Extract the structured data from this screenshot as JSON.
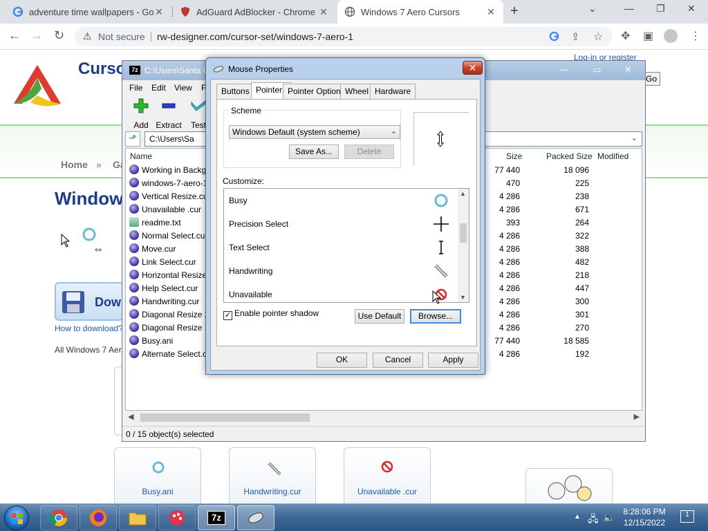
{
  "browser": {
    "tabs": [
      {
        "title": "adventure time wallpapers - Goo"
      },
      {
        "title": "AdGuard AdBlocker - Chrome W"
      },
      {
        "title": "Windows 7 Aero Cursors"
      }
    ],
    "new_tab_glyph": "+",
    "omnibox": {
      "security_label": "Not secure",
      "url": "rw-designer.com/cursor-set/windows-7-aero-1"
    }
  },
  "webpage": {
    "site_title": "Cursor",
    "login_text": "Log-in or register",
    "go_label": "Go",
    "breadcrumb": [
      "Home",
      "»",
      "Ga"
    ],
    "heading": "Window",
    "download_label": "Dow",
    "how_to": "How to download?",
    "all_windows": "All Windows 7 Aer",
    "cards": [
      {
        "name": "Busy.ani"
      },
      {
        "name": "Handwriting.cur"
      },
      {
        "name": "Unavailable .cur"
      }
    ]
  },
  "zip_window": {
    "title": "C:\\Users\\Santa C",
    "app_badge": "7z",
    "menu": [
      "File",
      "Edit",
      "View",
      "F"
    ],
    "tools": [
      {
        "label": "Add",
        "icon": "plus-icon"
      },
      {
        "label": "Extract",
        "icon": "minus-icon"
      },
      {
        "label": "Test",
        "icon": "check-icon"
      }
    ],
    "path": "C:\\Users\\Sa",
    "columns": {
      "name": "Name",
      "size": "Size",
      "packed": "Packed Size",
      "modified": "Modified"
    },
    "files": [
      {
        "name": "Working in Backg",
        "size": "77 440",
        "packed": "18 096"
      },
      {
        "name": "windows-7-aero-1",
        "size": "470",
        "packed": "225"
      },
      {
        "name": "Vertical Resize.cur",
        "size": "4 286",
        "packed": "238"
      },
      {
        "name": "Unavailable .cur",
        "size": "4 286",
        "packed": "671"
      },
      {
        "name": "readme.txt",
        "size": "393",
        "packed": "264",
        "type": "txt"
      },
      {
        "name": "Normal Select.cur",
        "size": "4 286",
        "packed": "322"
      },
      {
        "name": "Move.cur",
        "size": "4 286",
        "packed": "388"
      },
      {
        "name": "Link Select.cur",
        "size": "4 286",
        "packed": "482"
      },
      {
        "name": "Horizontal Resize.",
        "size": "4 286",
        "packed": "218"
      },
      {
        "name": "Help Select.cur",
        "size": "4 286",
        "packed": "447"
      },
      {
        "name": "Handwriting.cur",
        "size": "4 286",
        "packed": "300"
      },
      {
        "name": "Diagonal Resize 2.",
        "size": "4 286",
        "packed": "301"
      },
      {
        "name": "Diagonal Resize 1.",
        "size": "4 286",
        "packed": "270"
      },
      {
        "name": "Busy.ani",
        "size": "77 440",
        "packed": "18 585"
      },
      {
        "name": "Alternate Select.cu",
        "size": "4 286",
        "packed": "192"
      }
    ],
    "status": "0 / 15 object(s) selected"
  },
  "mouse_dialog": {
    "title": "Mouse Properties",
    "tabs": [
      "Buttons",
      "Pointers",
      "Pointer Options",
      "Wheel",
      "Hardware"
    ],
    "active_tab": "Pointers",
    "scheme_label": "Scheme",
    "scheme_value": "Windows Default (system scheme)",
    "save_as": "Save As...",
    "delete": "Delete",
    "customize_label": "Customize:",
    "pointers": [
      {
        "name": "Busy",
        "icon": "busy-ring-icon"
      },
      {
        "name": "Precision Select",
        "icon": "crosshair-icon"
      },
      {
        "name": "Text Select",
        "icon": "text-beam-icon"
      },
      {
        "name": "Handwriting",
        "icon": "pen-icon"
      },
      {
        "name": "Unavailable",
        "icon": "no-entry-icon"
      }
    ],
    "shadow_label": "Enable pointer shadow",
    "shadow_checked": true,
    "use_default": "Use Default",
    "browse": "Browse...",
    "ok": "OK",
    "cancel": "Cancel",
    "apply": "Apply"
  },
  "taskbar": {
    "clock_time": "8:28:06 PM",
    "clock_date": "12/15/2022",
    "notification_count": "1"
  }
}
